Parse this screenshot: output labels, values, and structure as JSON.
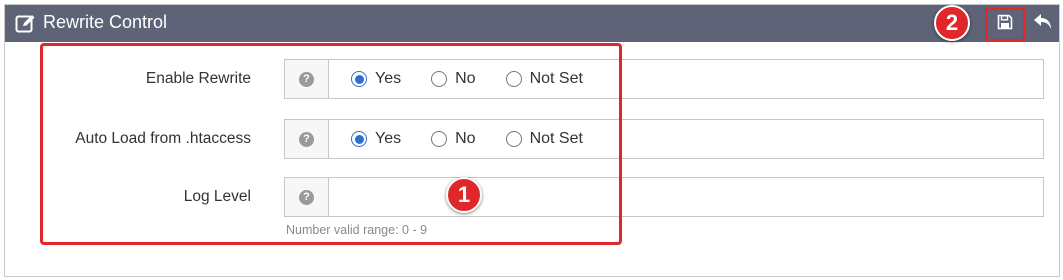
{
  "header": {
    "title": "Rewrite Control",
    "edit_icon": "edit-icon",
    "save_icon": "save-icon",
    "back_icon": "back-arrow-icon"
  },
  "callouts": {
    "one": "1",
    "two": "2"
  },
  "fields": [
    {
      "label": "Enable Rewrite",
      "help": "?",
      "options": [
        "Yes",
        "No",
        "Not Set"
      ],
      "selected": "Yes"
    },
    {
      "label": "Auto Load from .htaccess",
      "help": "?",
      "options": [
        "Yes",
        "No",
        "Not Set"
      ],
      "selected": "Yes"
    },
    {
      "label": "Log Level",
      "help": "?",
      "value": "",
      "hint": "Number valid range: 0 - 9"
    }
  ],
  "colors": {
    "header_bg": "#5e6377",
    "accent_red": "#e0282b",
    "radio_blue": "#2f6fd0"
  }
}
